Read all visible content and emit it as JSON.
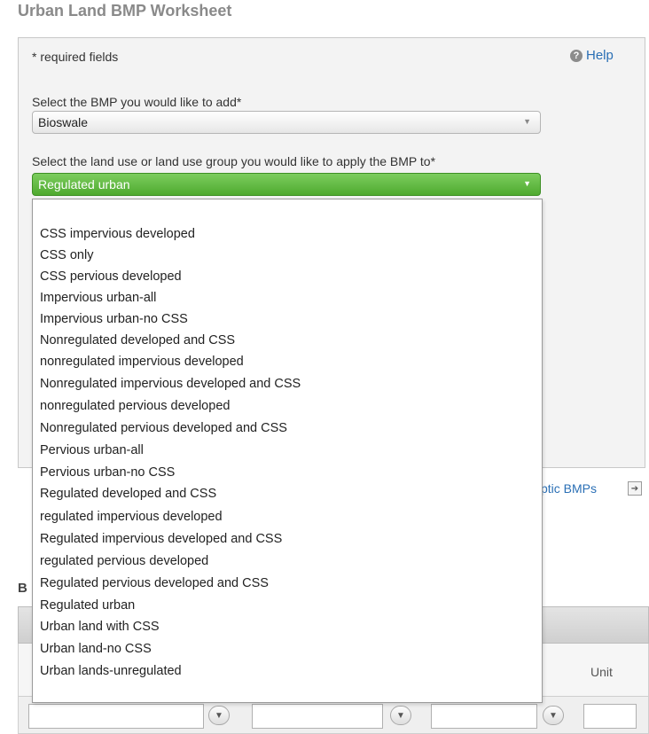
{
  "window": {
    "title": "Urban Land BMP Worksheet"
  },
  "form": {
    "required_note": "* required fields",
    "help_label": "Help",
    "help_icon": "question-circle-icon",
    "bmp_label": "Select the BMP you would like to add*",
    "bmp_value": "Bioswale",
    "landuse_label": "Select the land use or land use group you would like to apply the BMP to*",
    "landuse_value": "Regulated urban"
  },
  "dropdown": {
    "options": [
      "CSS impervious developed",
      "CSS only",
      "CSS pervious developed",
      "Impervious urban-all",
      "Impervious urban-no CSS",
      "Nonregulated developed and CSS",
      "nonregulated impervious developed",
      "Nonregulated impervious developed and CSS",
      "nonregulated pervious developed",
      "Nonregulated pervious developed and CSS",
      "Pervious urban-all",
      "Pervious urban-no CSS",
      "Regulated developed and CSS",
      "regulated impervious developed",
      "Regulated impervious developed and CSS",
      "regulated pervious developed",
      "Regulated pervious developed and CSS",
      "Regulated urban",
      "Urban land with CSS",
      "Urban land-no CSS",
      "Urban lands-unregulated"
    ]
  },
  "background": {
    "side_link": "ptic BMPs",
    "side_icon": "arrow-right-icon",
    "section_fragment": "B",
    "unit_header": "Unit",
    "filter_icon": "filter-icon"
  },
  "colors": {
    "accent_green": "#5bb53b",
    "link_blue": "#2a6fb5"
  }
}
